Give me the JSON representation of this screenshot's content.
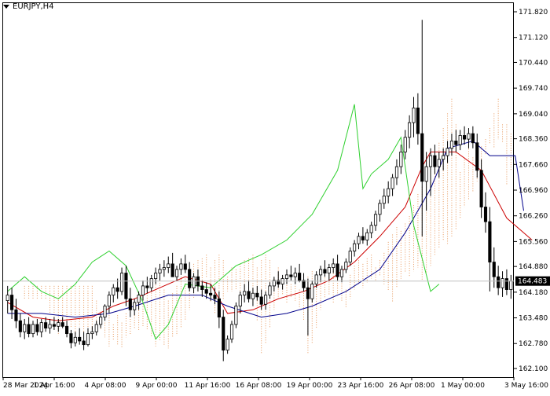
{
  "chart_data": {
    "type": "candlestick",
    "symbol_timeframe": "EURJPY,H4",
    "current_price": 164.483,
    "ylim": [
      162.1,
      171.82
    ],
    "y_ticks": [
      "171.820",
      "171.120",
      "170.440",
      "169.740",
      "169.040",
      "168.360",
      "167.660",
      "166.960",
      "166.260",
      "165.560",
      "164.880",
      "164.180",
      "163.480",
      "162.780",
      "162.100"
    ],
    "x_ticks": [
      "28 Mar 2024",
      "1 Apr 16:00",
      "4 Apr 08:00",
      "9 Apr 00:00",
      "11 Apr 16:00",
      "16 Apr 08:00",
      "19 Apr 00:00",
      "23 Apr 16:00",
      "26 Apr 08:00",
      "1 May 00:00",
      "3 May 16:00"
    ],
    "candles": [
      [
        163.95,
        164.35,
        163.6,
        164.1
      ],
      [
        164.1,
        164.3,
        163.45,
        163.7
      ],
      [
        163.7,
        164.0,
        163.2,
        163.4
      ],
      [
        163.4,
        163.6,
        162.95,
        163.1
      ],
      [
        163.1,
        163.45,
        162.9,
        163.3
      ],
      [
        163.3,
        163.5,
        162.95,
        163.05
      ],
      [
        163.05,
        163.4,
        162.95,
        163.3
      ],
      [
        163.3,
        163.45,
        163.0,
        163.1
      ],
      [
        163.1,
        163.45,
        162.95,
        163.35
      ],
      [
        163.35,
        163.5,
        163.1,
        163.2
      ],
      [
        163.2,
        163.45,
        163.05,
        163.3
      ],
      [
        163.3,
        163.5,
        163.15,
        163.25
      ],
      [
        163.25,
        163.45,
        163.1,
        163.35
      ],
      [
        163.35,
        163.5,
        163.2,
        163.25
      ],
      [
        163.25,
        163.4,
        162.95,
        163.05
      ],
      [
        163.05,
        163.15,
        162.65,
        162.8
      ],
      [
        162.8,
        163.1,
        162.7,
        162.95
      ],
      [
        162.95,
        163.2,
        162.75,
        162.85
      ],
      [
        162.85,
        163.1,
        162.6,
        162.75
      ],
      [
        162.75,
        163.2,
        162.7,
        163.05
      ],
      [
        163.05,
        163.25,
        162.9,
        163.1
      ],
      [
        163.1,
        163.4,
        163.0,
        163.3
      ],
      [
        163.3,
        163.6,
        163.2,
        163.5
      ],
      [
        163.5,
        163.85,
        163.4,
        163.8
      ],
      [
        163.8,
        164.2,
        163.6,
        164.1
      ],
      [
        164.1,
        164.4,
        163.9,
        164.3
      ],
      [
        164.3,
        164.55,
        164.0,
        164.2
      ],
      [
        164.2,
        164.85,
        164.1,
        164.7
      ],
      [
        164.7,
        164.9,
        163.8,
        164.0
      ],
      [
        164.0,
        164.3,
        163.5,
        163.7
      ],
      [
        163.7,
        164.0,
        163.55,
        163.9
      ],
      [
        163.9,
        164.2,
        163.7,
        164.1
      ],
      [
        164.1,
        164.5,
        163.95,
        164.35
      ],
      [
        164.35,
        164.6,
        164.15,
        164.3
      ],
      [
        164.3,
        164.65,
        164.2,
        164.55
      ],
      [
        164.55,
        164.85,
        164.4,
        164.7
      ],
      [
        164.7,
        164.95,
        164.5,
        164.8
      ],
      [
        164.8,
        165.05,
        164.6,
        164.85
      ],
      [
        164.85,
        165.15,
        164.7,
        164.95
      ],
      [
        164.95,
        165.25,
        164.8,
        164.6
      ],
      [
        164.6,
        164.9,
        164.5,
        164.8
      ],
      [
        164.8,
        165.1,
        164.65,
        164.95
      ],
      [
        164.95,
        165.2,
        164.7,
        164.8
      ],
      [
        164.8,
        165.0,
        164.2,
        164.3
      ],
      [
        164.3,
        164.7,
        164.15,
        164.6
      ],
      [
        164.6,
        164.8,
        164.2,
        164.35
      ],
      [
        164.35,
        164.5,
        164.05,
        164.25
      ],
      [
        164.25,
        164.45,
        164.0,
        164.15
      ],
      [
        164.15,
        164.4,
        163.95,
        164.1
      ],
      [
        164.1,
        164.3,
        163.85,
        164.0
      ],
      [
        164.0,
        164.2,
        163.2,
        163.5
      ],
      [
        163.5,
        163.7,
        162.3,
        162.6
      ],
      [
        162.6,
        163.0,
        162.5,
        162.9
      ],
      [
        162.9,
        163.4,
        162.8,
        163.3
      ],
      [
        163.3,
        163.9,
        163.2,
        163.8
      ],
      [
        163.8,
        164.2,
        163.6,
        164.1
      ],
      [
        164.1,
        164.4,
        163.9,
        164.2
      ],
      [
        164.2,
        164.5,
        163.9,
        164.0
      ],
      [
        164.0,
        164.3,
        163.8,
        164.15
      ],
      [
        164.15,
        164.35,
        163.95,
        164.05
      ],
      [
        164.05,
        164.25,
        163.7,
        163.85
      ],
      [
        163.85,
        164.2,
        163.7,
        164.1
      ],
      [
        164.1,
        164.45,
        164.0,
        164.35
      ],
      [
        164.35,
        164.6,
        164.2,
        164.5
      ],
      [
        164.5,
        164.75,
        164.3,
        164.4
      ],
      [
        164.4,
        164.65,
        164.25,
        164.55
      ],
      [
        164.55,
        164.8,
        164.4,
        164.65
      ],
      [
        164.65,
        164.9,
        164.5,
        164.6
      ],
      [
        164.6,
        164.85,
        164.4,
        164.7
      ],
      [
        164.7,
        164.95,
        164.45,
        164.5
      ],
      [
        164.5,
        164.7,
        164.2,
        164.3
      ],
      [
        164.3,
        164.55,
        163.0,
        164.0
      ],
      [
        164.0,
        164.5,
        163.9,
        164.4
      ],
      [
        164.4,
        164.75,
        164.3,
        164.65
      ],
      [
        164.65,
        164.9,
        164.45,
        164.8
      ],
      [
        164.8,
        165.05,
        164.6,
        164.7
      ],
      [
        164.7,
        164.95,
        164.5,
        164.85
      ],
      [
        164.85,
        165.1,
        164.7,
        164.95
      ],
      [
        164.95,
        165.2,
        164.5,
        164.6
      ],
      [
        164.6,
        164.9,
        164.45,
        164.8
      ],
      [
        164.8,
        165.1,
        164.7,
        165.0
      ],
      [
        165.0,
        165.4,
        164.9,
        165.3
      ],
      [
        165.3,
        165.6,
        165.15,
        165.5
      ],
      [
        165.5,
        165.8,
        165.35,
        165.7
      ],
      [
        165.7,
        165.95,
        165.5,
        165.6
      ],
      [
        165.6,
        165.9,
        165.45,
        165.8
      ],
      [
        165.8,
        166.1,
        165.65,
        166.0
      ],
      [
        166.0,
        166.4,
        165.85,
        166.3
      ],
      [
        166.3,
        166.7,
        166.1,
        166.6
      ],
      [
        166.6,
        167.0,
        166.45,
        166.8
      ],
      [
        166.8,
        167.2,
        166.6,
        167.0
      ],
      [
        167.0,
        167.4,
        166.8,
        167.3
      ],
      [
        167.3,
        167.8,
        167.1,
        167.6
      ],
      [
        167.6,
        168.2,
        167.4,
        168.0
      ],
      [
        168.0,
        168.6,
        167.8,
        168.4
      ],
      [
        168.4,
        169.0,
        168.1,
        168.8
      ],
      [
        168.8,
        169.5,
        168.4,
        169.2
      ],
      [
        169.2,
        169.6,
        168.2,
        168.5
      ],
      [
        168.5,
        171.6,
        165.7,
        167.2
      ],
      [
        167.2,
        168.0,
        166.4,
        167.6
      ],
      [
        167.6,
        168.1,
        166.8,
        167.9
      ],
      [
        167.9,
        168.2,
        167.4,
        167.6
      ],
      [
        167.6,
        168.0,
        167.3,
        167.8
      ],
      [
        167.8,
        168.1,
        167.5,
        167.9
      ],
      [
        167.9,
        168.3,
        167.7,
        168.1
      ],
      [
        168.1,
        168.5,
        167.9,
        168.3
      ],
      [
        168.3,
        168.6,
        168.0,
        168.2
      ],
      [
        168.2,
        168.6,
        168.05,
        168.45
      ],
      [
        168.45,
        168.7,
        168.2,
        168.35
      ],
      [
        168.35,
        168.65,
        168.1,
        168.5
      ],
      [
        168.5,
        168.7,
        168.1,
        168.25
      ],
      [
        168.25,
        168.5,
        167.3,
        167.5
      ],
      [
        167.5,
        167.8,
        166.2,
        166.5
      ],
      [
        166.5,
        166.9,
        165.8,
        166.1
      ],
      [
        166.1,
        166.5,
        164.2,
        165.0
      ],
      [
        165.0,
        165.4,
        164.3,
        164.6
      ],
      [
        164.6,
        164.9,
        164.1,
        164.3
      ],
      [
        164.3,
        164.75,
        164.05,
        164.55
      ],
      [
        164.55,
        164.8,
        164.1,
        164.25
      ],
      [
        164.25,
        164.65,
        164.0,
        164.483
      ]
    ],
    "series": [
      {
        "color": "#cc0000",
        "points": [
          [
            0,
            163.9
          ],
          [
            6,
            163.5
          ],
          [
            12,
            163.4
          ],
          [
            20,
            163.5
          ],
          [
            25,
            163.8
          ],
          [
            30,
            164.0
          ],
          [
            36,
            164.3
          ],
          [
            42,
            164.6
          ],
          [
            48,
            164.4
          ],
          [
            52,
            163.6
          ],
          [
            58,
            163.7
          ],
          [
            64,
            164.0
          ],
          [
            70,
            164.2
          ],
          [
            76,
            164.5
          ],
          [
            82,
            165.0
          ],
          [
            88,
            165.7
          ],
          [
            94,
            166.5
          ],
          [
            98,
            167.6
          ],
          [
            100,
            168.0
          ],
          [
            106,
            168.0
          ],
          [
            112,
            167.5
          ],
          [
            118,
            166.2
          ],
          [
            124,
            165.6
          ]
        ]
      },
      {
        "color": "#00008b",
        "points": [
          [
            0,
            163.6
          ],
          [
            8,
            163.6
          ],
          [
            16,
            163.5
          ],
          [
            24,
            163.6
          ],
          [
            30,
            163.8
          ],
          [
            38,
            164.1
          ],
          [
            46,
            164.1
          ],
          [
            52,
            163.8
          ],
          [
            60,
            163.5
          ],
          [
            66,
            163.6
          ],
          [
            72,
            163.8
          ],
          [
            80,
            164.2
          ],
          [
            88,
            164.8
          ],
          [
            94,
            165.8
          ],
          [
            100,
            167.0
          ],
          [
            104,
            168.1
          ],
          [
            110,
            168.3
          ],
          [
            114,
            167.9
          ],
          [
            120,
            167.9
          ],
          [
            122,
            166.4
          ]
        ]
      },
      {
        "color": "#2fd02f",
        "points": [
          [
            0,
            164.2
          ],
          [
            4,
            164.6
          ],
          [
            8,
            164.2
          ],
          [
            12,
            164.0
          ],
          [
            16,
            164.4
          ],
          [
            20,
            165.0
          ],
          [
            24,
            165.3
          ],
          [
            28,
            164.9
          ],
          [
            32,
            163.9
          ],
          [
            35,
            162.9
          ],
          [
            38,
            163.3
          ],
          [
            42,
            164.4
          ],
          [
            48,
            164.3
          ],
          [
            54,
            164.9
          ],
          [
            60,
            165.2
          ],
          [
            66,
            165.6
          ],
          [
            72,
            166.3
          ],
          [
            78,
            167.5
          ],
          [
            82,
            169.3
          ],
          [
            84,
            167.0
          ],
          [
            86,
            167.4
          ],
          [
            90,
            167.8
          ],
          [
            93,
            168.4
          ],
          [
            96,
            166.0
          ],
          [
            100,
            164.2
          ],
          [
            102,
            164.4
          ]
        ]
      }
    ]
  }
}
